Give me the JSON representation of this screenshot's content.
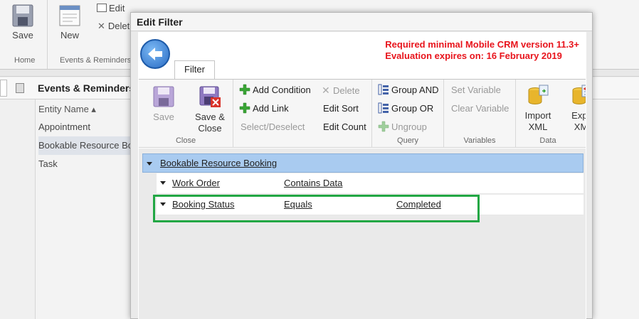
{
  "background": {
    "ribbon": {
      "save_label": "Save",
      "new_label": "New",
      "edit_label": "Edit",
      "delete_label": "Delet",
      "group_home": "Home",
      "group_events": "Events & Reminders"
    },
    "list_title": "Events & Reminders",
    "column_header": "Entity Name ▴",
    "rows": [
      "Appointment",
      "Bookable Resource Bo",
      "Task"
    ]
  },
  "dialog": {
    "title": "Edit Filter",
    "tab_label": "Filter",
    "notice_line1": "Required minimal Mobile CRM version 11.3+",
    "notice_line2": "Evaluation expires on: 16 February 2019",
    "ribbon": {
      "close_group": {
        "label": "Close",
        "save": "Save",
        "save_close_1": "Save &",
        "save_close_2": "Close"
      },
      "edit_group": {
        "add_condition": "Add Condition",
        "add_link": "Add Link",
        "select_deselect": "Select/Deselect",
        "delete": "Delete",
        "edit_sort": "Edit Sort",
        "edit_count": "Edit Count"
      },
      "query_group": {
        "label": "Query",
        "group_and": "Group AND",
        "group_or": "Group OR",
        "ungroup": "Ungroup"
      },
      "variables_group": {
        "label": "Variables",
        "set_variable": "Set Variable",
        "clear_variable": "Clear Variable"
      },
      "data_group": {
        "label": "Data",
        "import_1": "Import",
        "import_2": "XML",
        "export_1": "Expo",
        "export_2": "XMl"
      }
    },
    "tree": {
      "root": "Bookable Resource Booking",
      "rows": [
        {
          "field": "Work Order",
          "operator": "Contains Data",
          "value": ""
        },
        {
          "field": "Booking Status",
          "operator": "Equals",
          "value": "Completed"
        }
      ]
    }
  },
  "colors": {
    "notice": "#e8141c",
    "highlight": "#22a744",
    "root_row": "#a9cbf0"
  }
}
